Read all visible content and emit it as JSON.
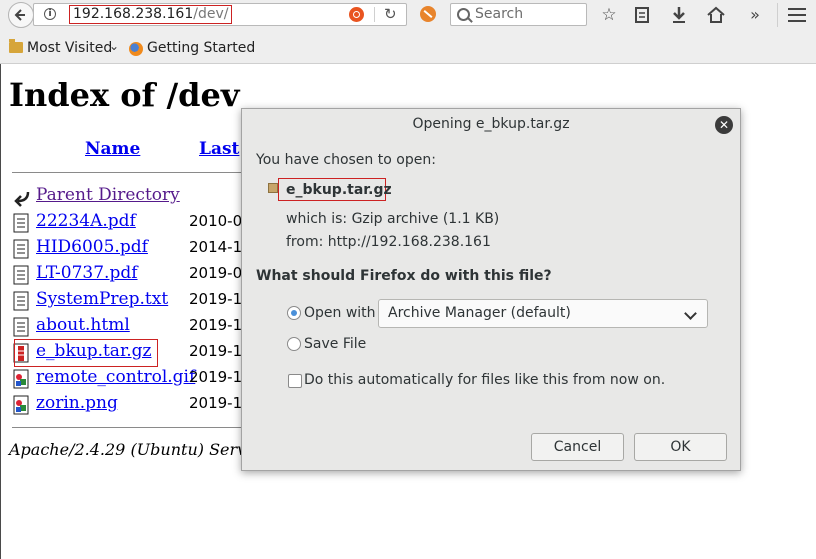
{
  "browser": {
    "url_host": "192.168.238.161",
    "url_path": "/dev/",
    "search_placeholder": "Search",
    "bookmarks": [
      {
        "label": "Most Visited",
        "icon": "folder-icon"
      },
      {
        "label": "Getting Started",
        "icon": "firefox-icon"
      }
    ]
  },
  "page": {
    "title": "Index of /dev",
    "columns": {
      "name": "Name",
      "last_modified": "Last"
    },
    "rows": [
      {
        "name": "Parent Directory",
        "date": "",
        "icon": "back-arrow-icon"
      },
      {
        "name": "22234A.pdf",
        "date": "2010-0",
        "icon": "text-file-icon"
      },
      {
        "name": "HID6005.pdf",
        "date": "2014-1",
        "icon": "text-file-icon"
      },
      {
        "name": "LT-0737.pdf",
        "date": "2019-0",
        "icon": "text-file-icon"
      },
      {
        "name": "SystemPrep.txt",
        "date": "2019-1",
        "icon": "text-file-icon"
      },
      {
        "name": "about.html",
        "date": "2019-1",
        "icon": "text-file-icon"
      },
      {
        "name": "e_bkup.tar.gz",
        "date": "2019-1",
        "icon": "archive-file-icon"
      },
      {
        "name": "remote_control.gif",
        "date": "2019-1",
        "icon": "image-file-icon"
      },
      {
        "name": "zorin.png",
        "date": "2019-1",
        "icon": "image-file-icon"
      }
    ],
    "footer": "Apache/2.4.29 (Ubuntu) Serv"
  },
  "dialog": {
    "title": "Opening e_bkup.tar.gz",
    "chosen_label": "You have chosen to open:",
    "file_name": "e_bkup.tar.gz",
    "which_is": "which is:  Gzip archive (1.1 KB)",
    "from": "from:  http://192.168.238.161",
    "question": "What should Firefox do with this file?",
    "open_with_label": "Open with",
    "open_with_app": "Archive Manager (default)",
    "save_file_label": "Save File",
    "auto_label": "Do this automatically for files like this from now on.",
    "open_with_selected": true,
    "auto_checked": false,
    "cancel_label": "Cancel",
    "ok_label": "OK"
  },
  "colors": {
    "link": "#0000ee",
    "visited_link": "#551a8b",
    "annotation_box": "#cc2222",
    "dialog_bg": "#e8e8e7"
  }
}
